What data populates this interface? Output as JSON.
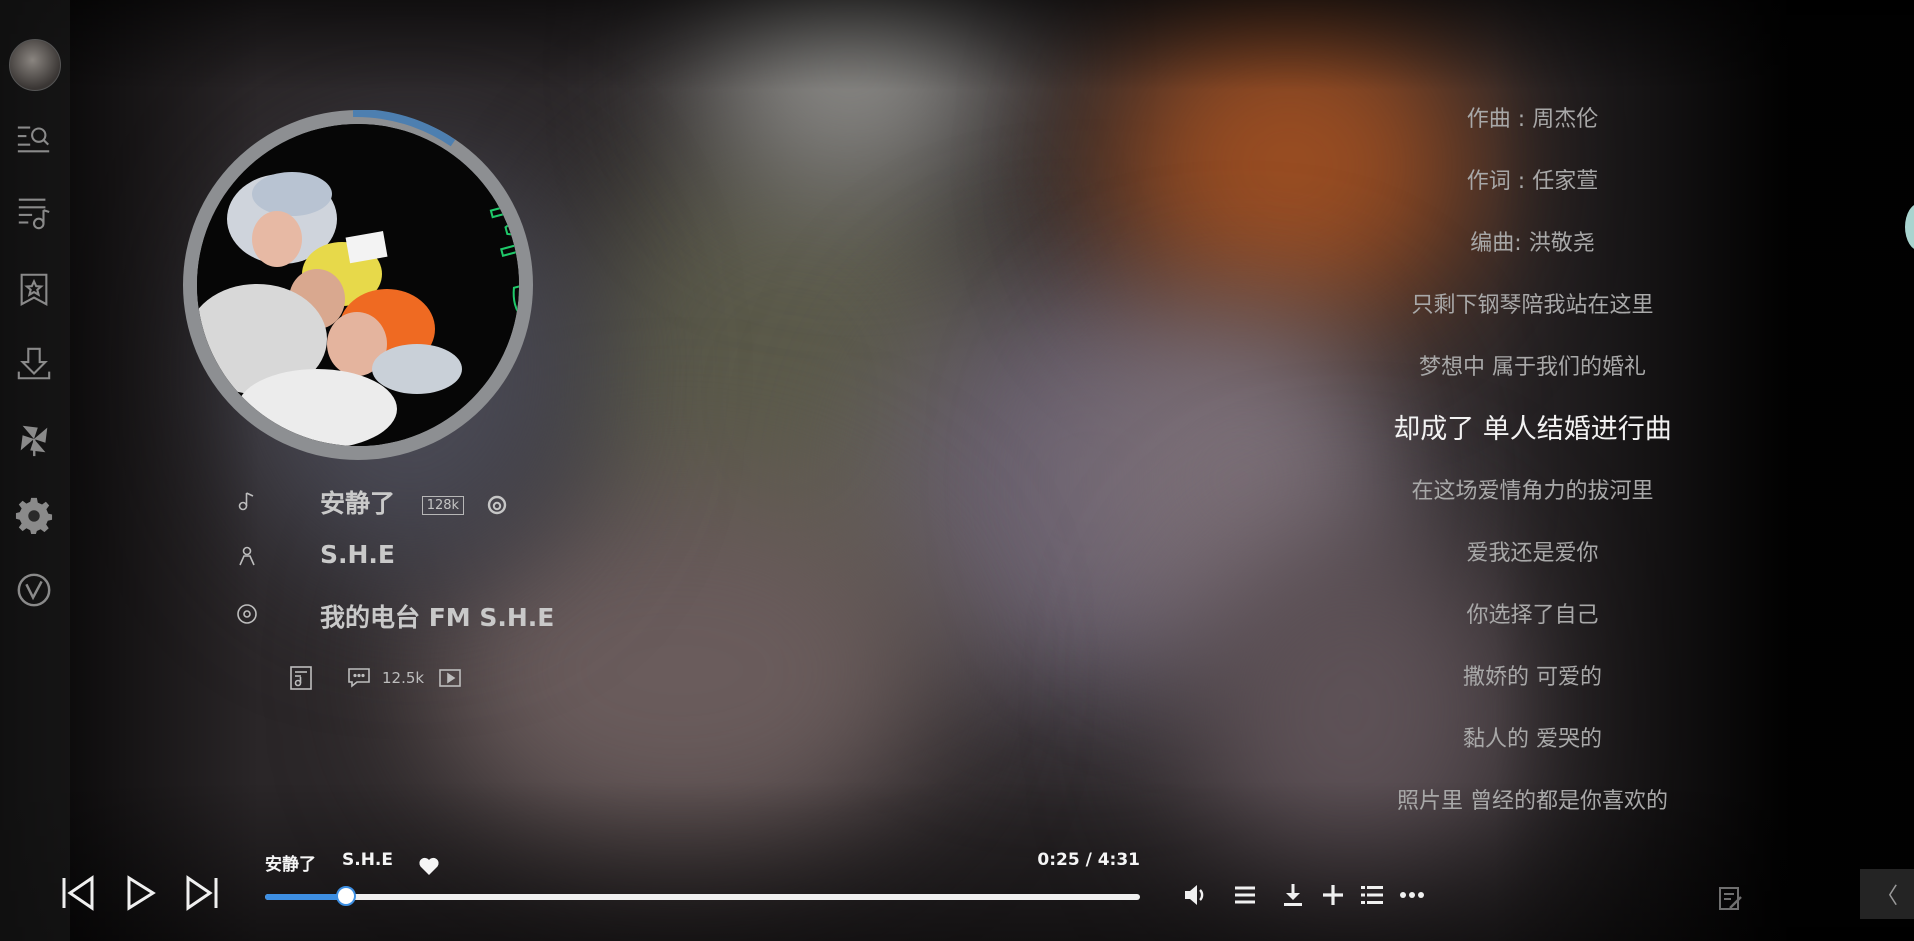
{
  "song": {
    "title": "安静了",
    "quality": "128k",
    "artist": "S.H.E",
    "album": "我的电台 FM S.H.E",
    "comment_count": "12.5k"
  },
  "lyrics": [
    "作曲 : 周杰伦",
    "作词 : 任家萱",
    "编曲:  洪敬尧",
    "只剩下钢琴陪我站在这里",
    "梦想中 属于我们的婚礼",
    "却成了 单人结婚进行曲",
    "在这场爱情角力的拔河里",
    "爱我还是爱你",
    "你选择了自己",
    "撒娇的 可爱的",
    "黏人的 爱哭的",
    "照片里 曾经的都是你喜欢的"
  ],
  "active_lyric_index": 5,
  "player": {
    "title": "安静了",
    "artist": "S.H.E",
    "time": "0:25 / 4:31",
    "progress_fraction": 0.092
  },
  "collapse_glyph": "〈",
  "colors": {
    "accent": "#3d8fe3",
    "track": "#f0f0f0",
    "lyric": "#a8a8a8",
    "lyric_active": "#f2f2f2"
  },
  "icons": {
    "sidebar": [
      "search-list-icon",
      "playlist-icon",
      "favorites-icon",
      "download-icon",
      "pinwheel-icon",
      "gear-icon",
      "v-logo-icon"
    ],
    "controls": [
      "volume-icon",
      "menu-icon",
      "download-icon",
      "add-icon",
      "queue-icon",
      "more-icon"
    ]
  }
}
